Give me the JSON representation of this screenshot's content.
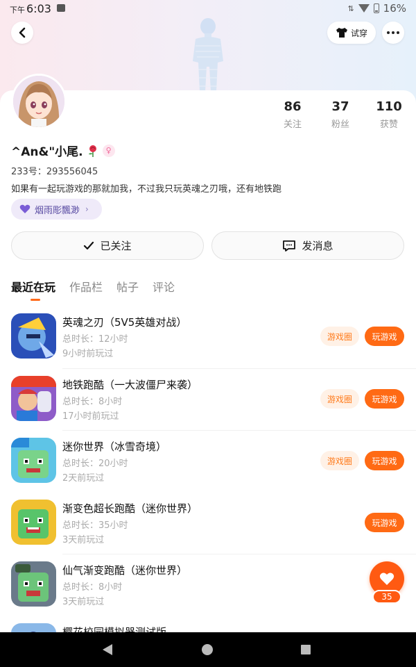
{
  "status_bar": {
    "period": "下午",
    "time": "6:03",
    "battery": "16%"
  },
  "header": {
    "try_on_label": "试穿"
  },
  "profile": {
    "stats": [
      {
        "value": "86",
        "label": "关注"
      },
      {
        "value": "37",
        "label": "粉丝"
      },
      {
        "value": "110",
        "label": "获赞"
      }
    ],
    "nickname": "^An&\"小尾.",
    "uid": "233号：293556045",
    "bio": "如果有一起玩游戏的那就加我，不过我只玩英魂之刃哦，还有地铁跑",
    "tag": "烟雨彫飄渺",
    "follow_label": "已关注",
    "message_label": "发消息"
  },
  "tabs": [
    "最近在玩",
    "作品栏",
    "帖子",
    "评论"
  ],
  "games": [
    {
      "title": "英魂之刃（5V5英雄对战）",
      "duration": "总时长：12小时",
      "last_played": "9小时前玩过",
      "circle_label": "游戏圈",
      "play_label": "玩游戏",
      "icon": "hero-game-icon"
    },
    {
      "title": "地铁跑酷（一大波僵尸来袭）",
      "duration": "总时长：8小时",
      "last_played": "17小时前玩过",
      "circle_label": "游戏圈",
      "play_label": "玩游戏",
      "icon": "subway-game-icon"
    },
    {
      "title": "迷你世界（冰雪奇境）",
      "duration": "总时长：20小时",
      "last_played": "2天前玩过",
      "circle_label": "游戏圈",
      "play_label": "玩游戏",
      "icon": "mini-world-icon"
    },
    {
      "title": "渐变色超长跑酷（迷你世界）",
      "duration": "总时长：35小时",
      "last_played": "3天前玩过",
      "circle_label": "",
      "play_label": "玩游戏",
      "icon": "mini-world-parkour-icon"
    },
    {
      "title": "仙气渐变跑酷（迷你世界）",
      "duration": "总时长：8小时",
      "last_played": "3天前玩过",
      "circle_label": "",
      "play_label": "",
      "icon": "mini-world-fairy-icon"
    },
    {
      "title": "樱花校园模拟器测试版",
      "duration": "",
      "last_played": "",
      "circle_label": "",
      "play_label": "",
      "icon": "sakura-school-icon"
    }
  ],
  "fab": {
    "count": "35"
  },
  "colors": {
    "accent": "#ff6a14",
    "accent_light": "#fff1e6",
    "tag_bg": "#efeaf9"
  }
}
